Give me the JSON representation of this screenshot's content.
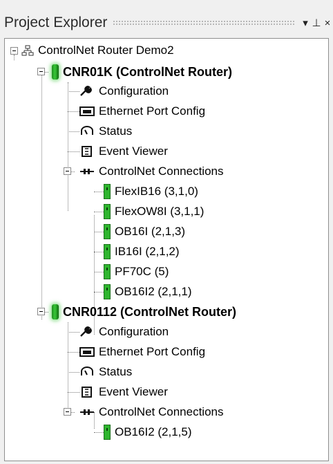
{
  "panel": {
    "title": "Project Explorer",
    "dropdown_glyph": "▾",
    "pin_glyph": "⊥",
    "close_glyph": "×"
  },
  "tree": {
    "root": {
      "label": "ControlNet Router Demo2",
      "icon": "project-icon"
    },
    "routers": [
      {
        "label": "CNR01K (ControlNet Router)",
        "children": {
          "configuration": "Configuration",
          "ethernet": "Ethernet Port Config",
          "status": "Status",
          "events": "Event Viewer",
          "connections": "ControlNet Connections"
        },
        "modules": [
          "FlexIB16 (3,1,0)",
          "FlexOW8I (3,1,1)",
          "OB16I (2,1,3)",
          "IB16I (2,1,2)",
          "PF70C (5)",
          "OB16I2 (2,1,1)"
        ]
      },
      {
        "label": "CNR0112 (ControlNet Router)",
        "children": {
          "configuration": "Configuration",
          "ethernet": "Ethernet Port Config",
          "status": "Status",
          "events": "Event Viewer",
          "connections": "ControlNet Connections"
        },
        "modules": [
          "OB16I2 (2,1,5)"
        ]
      }
    ]
  },
  "colors": {
    "router_green": "#37c837",
    "module_green": "#2fb52f",
    "tree_bg": "#ffffff",
    "panel_bg": "#f0f0f0"
  }
}
